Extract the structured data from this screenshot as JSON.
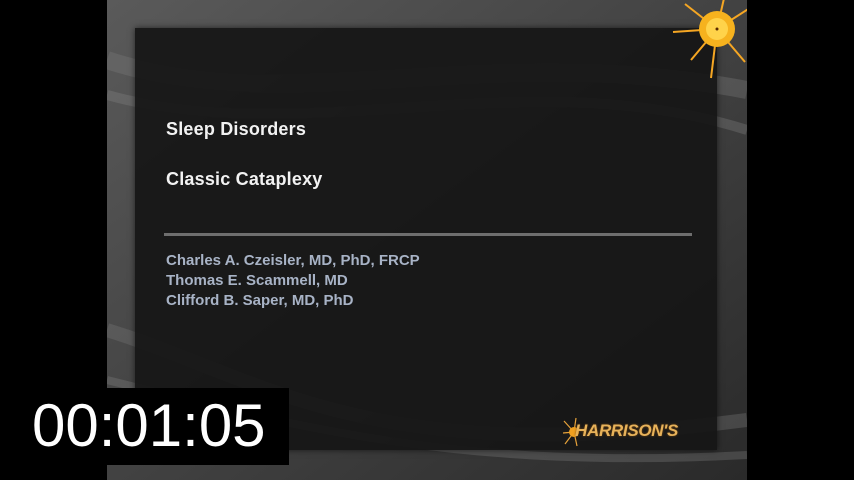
{
  "slide": {
    "title": "Sleep Disorders",
    "subtitle": "Classic Cataplexy",
    "authors": [
      "Charles A. Czeisler, MD, PhD, FRCP",
      "Thomas E. Scammell, MD",
      "Clifford B. Saper, MD, PhD"
    ],
    "logo_text": "HARRISON'S",
    "logo_icon": "sun-icon"
  },
  "timer": {
    "value": "00:01:05"
  },
  "colors": {
    "panel": "#161616",
    "title_text": "#f2f2f2",
    "author_text": "#a8b3c6",
    "logo_gold": "#e7b25a",
    "sun": "#f5a623"
  }
}
